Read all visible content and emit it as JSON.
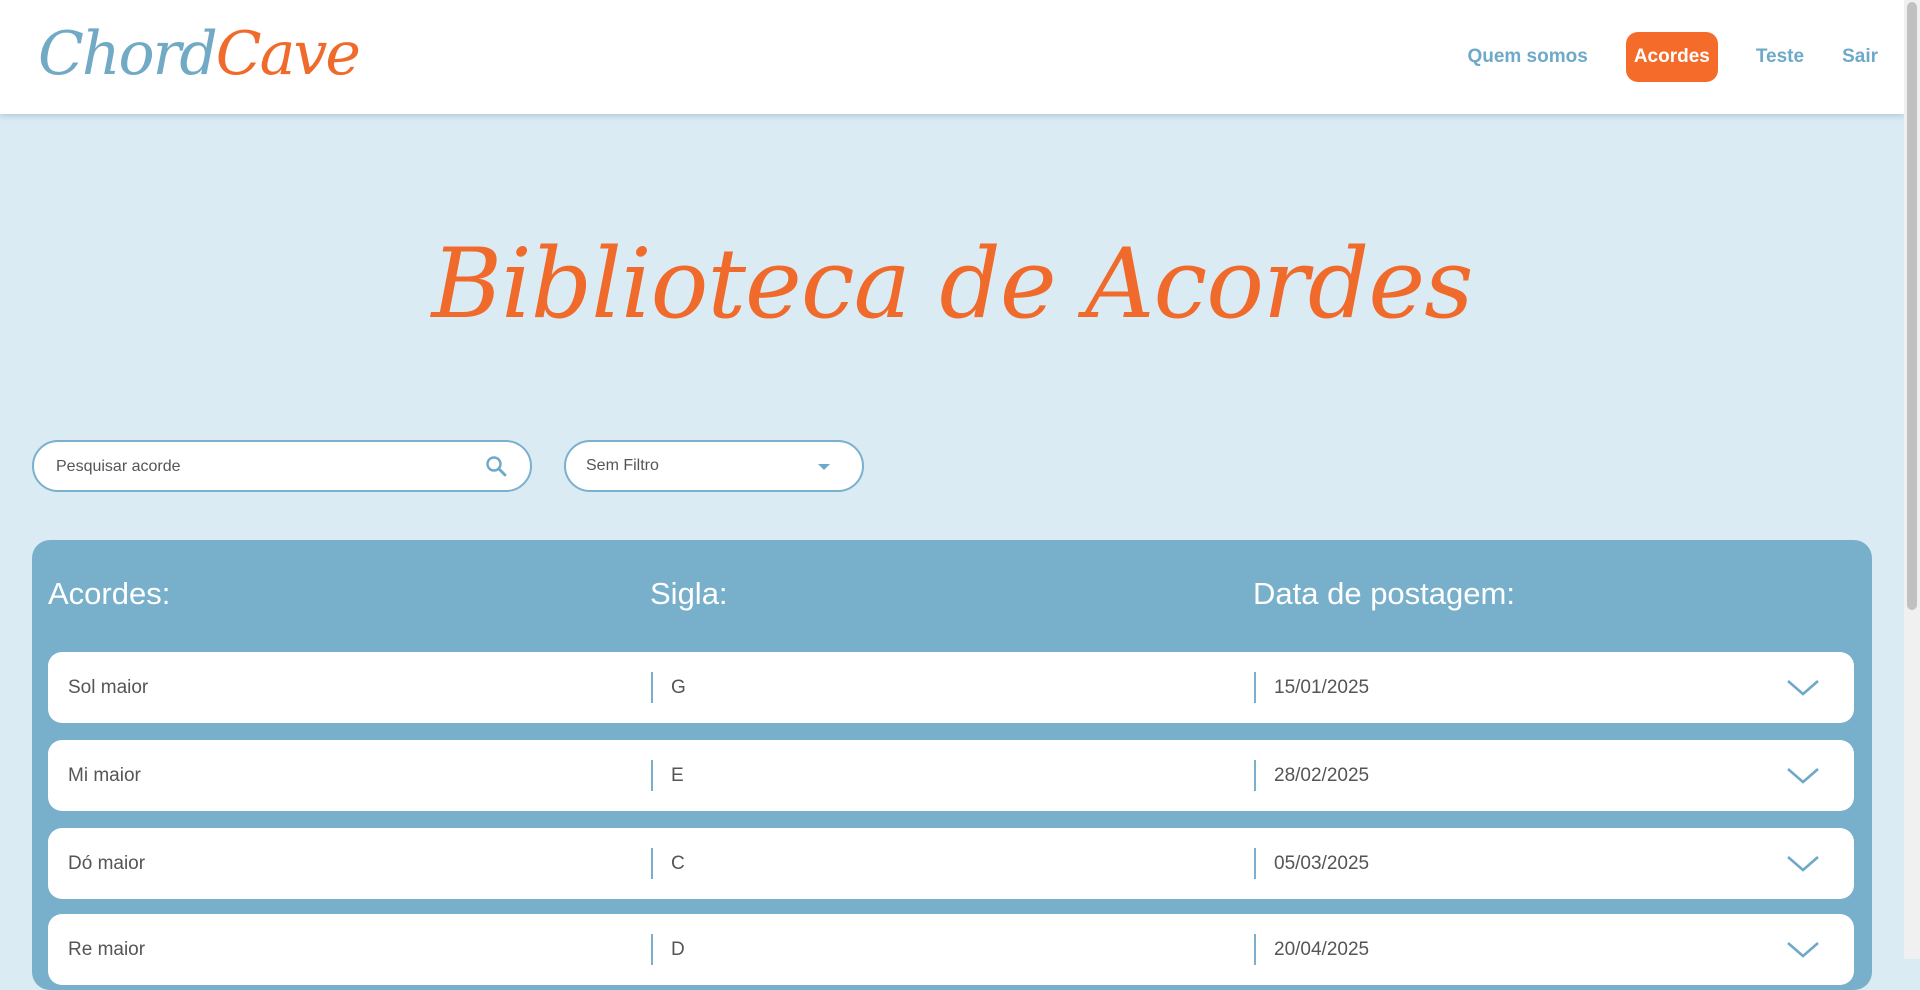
{
  "header": {
    "logo_part1": "Chord",
    "logo_part2": "Cave",
    "nav": [
      {
        "label": "Quem somos",
        "active": false
      },
      {
        "label": "Acordes",
        "active": true
      },
      {
        "label": "Teste",
        "active": false
      },
      {
        "label": "Sair",
        "active": false
      }
    ]
  },
  "page": {
    "title": "Biblioteca de Acordes"
  },
  "search": {
    "placeholder": "Pesquisar acorde",
    "icon": "search-icon"
  },
  "filter": {
    "selected": "Sem Filtro",
    "icon": "caret-down-icon"
  },
  "table": {
    "headers": {
      "name": "Acordes:",
      "symbol": "Sigla:",
      "date": "Data de postagem:"
    },
    "rows": [
      {
        "name": "Sol maior",
        "symbol": "G",
        "date": "15/01/2025"
      },
      {
        "name": "Mi maior",
        "symbol": "E",
        "date": "28/02/2025"
      },
      {
        "name": "Dó maior",
        "symbol": "C",
        "date": "05/03/2025"
      },
      {
        "name": "Re maior",
        "symbol": "D",
        "date": "20/04/2025"
      }
    ]
  },
  "colors": {
    "brand_orange": "#f06a2c",
    "brand_blue": "#72aac6",
    "page_background": "#dbebf3",
    "panel_background": "#78b0cc"
  }
}
